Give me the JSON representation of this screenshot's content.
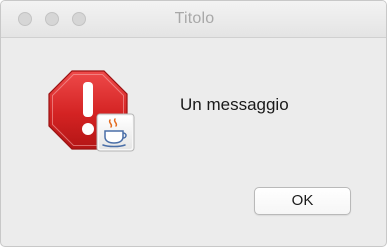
{
  "window": {
    "title": "Titolo"
  },
  "dialog": {
    "message": "Un messaggio",
    "ok_label": "OK",
    "icons": [
      "alert-octagon-icon",
      "java-coffee-cup-icon"
    ]
  },
  "colors": {
    "alert_red": "#cc1f1f",
    "background": "#ececec"
  }
}
